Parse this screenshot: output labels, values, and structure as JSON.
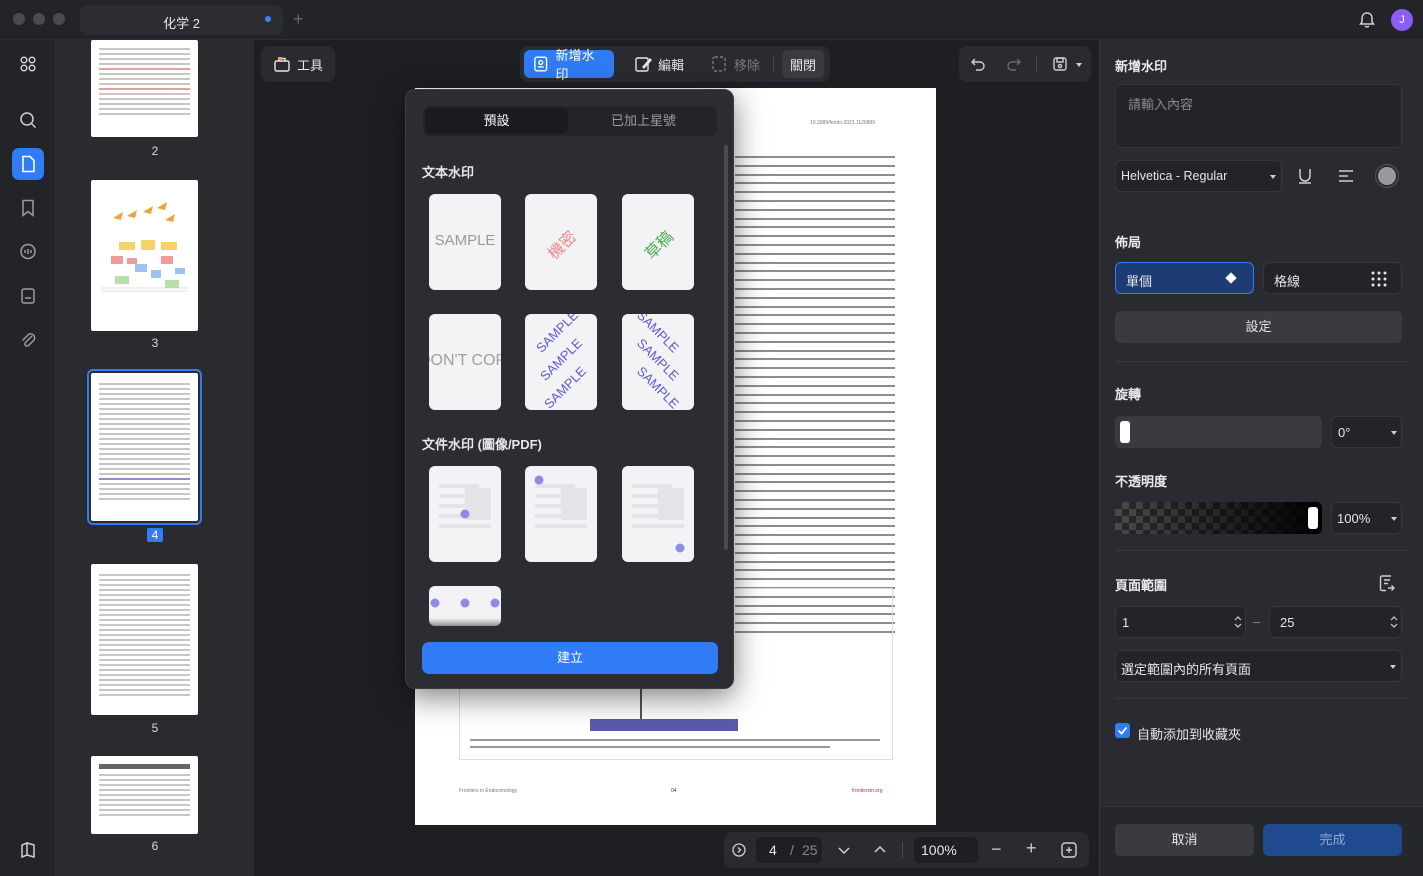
{
  "window": {
    "tab_title": "化学 2",
    "avatar_initial": "J"
  },
  "main_toolbar": {
    "tools_label": "工具",
    "add_watermark_label": "新增水印",
    "edit_label": "編輯",
    "remove_label": "移除",
    "close_label": "關閉"
  },
  "thumbnails": [
    {
      "label": "2"
    },
    {
      "label": "3"
    },
    {
      "label": "4",
      "selected": true
    },
    {
      "label": "5"
    },
    {
      "label": "6"
    }
  ],
  "document": {
    "doi": "10.3389/fendo.2023.1126889",
    "footer_left": "Frontiers in Endocrinology",
    "footer_center": "04",
    "footer_right": "frontiersin.org"
  },
  "bottom_nav": {
    "current_page": "4",
    "separator": "/",
    "total_pages": "25",
    "zoom": "100%"
  },
  "popover": {
    "tabs": [
      {
        "label": "預設",
        "active": true
      },
      {
        "label": "已加上星號",
        "active": false
      }
    ],
    "text_section_title": "文本水印",
    "file_section_title": "文件水印 (圖像/PDF)",
    "text_samples": {
      "sample": "SAMPLE",
      "confidential": "機密",
      "draft": "草稿",
      "dont_copy": "DON'T COPY"
    },
    "create_label": "建立"
  },
  "panel": {
    "title": "新增水印",
    "content_placeholder": "請輸入內容",
    "font_value": "Helvetica - Regular",
    "layout_title": "佈局",
    "layout_single": "單個",
    "layout_grid": "格線",
    "settings_label": "設定",
    "rotate_title": "旋轉",
    "rotate_value": "0°",
    "rotation_level": 0,
    "opacity_title": "不透明度",
    "opacity_value": "100%",
    "opacity_level": 1.0,
    "range_title": "頁面範圍",
    "range_from": "1",
    "range_dash": "–",
    "range_to": "25",
    "range_option": "選定範圍內的所有頁面",
    "auto_add_label": "自動添加到收藏夾",
    "cancel_label": "取消",
    "done_label": "完成",
    "text_color": "#9a9a9a"
  },
  "colors": {
    "accent": "#2f7cf6",
    "watermark_red": "#e88a8a",
    "watermark_green": "#4caf50",
    "watermark_purple": "#5b5bd6"
  }
}
